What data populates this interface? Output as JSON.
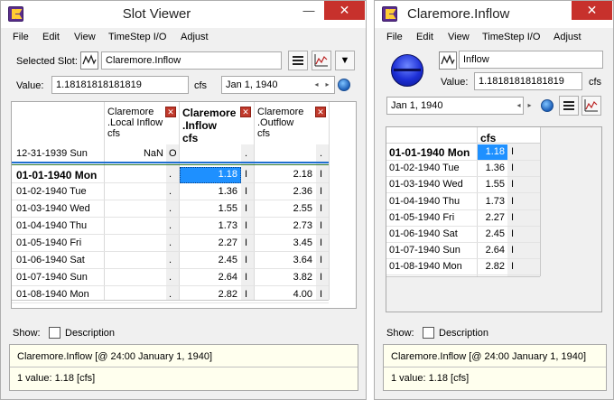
{
  "left_window": {
    "title": "Slot Viewer",
    "menu": [
      "File",
      "Edit",
      "View",
      "TimeStep I/O",
      "Adjust"
    ],
    "selected_slot_label": "Selected Slot:",
    "selected_slot_value": "Claremore.Inflow",
    "value_label": "Value:",
    "value": "1.18181818181819",
    "units": "cfs",
    "date": "Jan 1, 1940",
    "columns": [
      {
        "line1": "Claremore",
        "line2": ".Local Inflow",
        "line3": "cfs"
      },
      {
        "line1": "Claremore",
        "line2": ".Inflow",
        "line3": "cfs"
      },
      {
        "line1": "Claremore",
        "line2": ".Outflow",
        "line3": "cfs"
      }
    ],
    "pre_row": {
      "date": "12-31-1939 Sun",
      "c1": "NaN",
      "f1": "O",
      "f2": ".",
      "f3": "."
    },
    "rows": [
      {
        "date": "01-01-1940 Mon",
        "f1": ".",
        "v2": "1.18",
        "f2": "I",
        "v3": "2.18",
        "f3": "I"
      },
      {
        "date": "01-02-1940 Tue",
        "f1": ".",
        "v2": "1.36",
        "f2": "I",
        "v3": "2.36",
        "f3": "I"
      },
      {
        "date": "01-03-1940 Wed",
        "f1": ".",
        "v2": "1.55",
        "f2": "I",
        "v3": "2.55",
        "f3": "I"
      },
      {
        "date": "01-04-1940 Thu",
        "f1": ".",
        "v2": "1.73",
        "f2": "I",
        "v3": "2.73",
        "f3": "I"
      },
      {
        "date": "01-05-1940 Fri",
        "f1": ".",
        "v2": "2.27",
        "f2": "I",
        "v3": "3.45",
        "f3": "I"
      },
      {
        "date": "01-06-1940 Sat",
        "f1": ".",
        "v2": "2.45",
        "f2": "I",
        "v3": "3.64",
        "f3": "I"
      },
      {
        "date": "01-07-1940 Sun",
        "f1": ".",
        "v2": "2.64",
        "f2": "I",
        "v3": "3.82",
        "f3": "I"
      },
      {
        "date": "01-08-1940 Mon",
        "f1": ".",
        "v2": "2.82",
        "f2": "I",
        "v3": "4.00",
        "f3": "I"
      }
    ],
    "show_label": "Show:",
    "description_label": "Description",
    "info_line1": "Claremore.Inflow [@ 24:00 January 1, 1940]",
    "info_line2": "1 value:  1.18 [cfs]"
  },
  "right_window": {
    "title": "Claremore.Inflow",
    "menu": [
      "File",
      "Edit",
      "View",
      "TimeStep I/O",
      "Adjust"
    ],
    "slot_name": "Inflow",
    "value_label": "Value:",
    "value": "1.18181818181819",
    "units": "cfs",
    "date": "Jan 1, 1940",
    "column_header": "cfs",
    "rows": [
      {
        "date": "01-01-1940 Mon",
        "v": "1.18",
        "f": "I"
      },
      {
        "date": "01-02-1940 Tue",
        "v": "1.36",
        "f": "I"
      },
      {
        "date": "01-03-1940 Wed",
        "v": "1.55",
        "f": "I"
      },
      {
        "date": "01-04-1940 Thu",
        "v": "1.73",
        "f": "I"
      },
      {
        "date": "01-05-1940 Fri",
        "v": "2.27",
        "f": "I"
      },
      {
        "date": "01-06-1940 Sat",
        "v": "2.45",
        "f": "I"
      },
      {
        "date": "01-07-1940 Sun",
        "v": "2.64",
        "f": "I"
      },
      {
        "date": "01-08-1940 Mon",
        "v": "2.82",
        "f": "I"
      }
    ],
    "show_label": "Show:",
    "description_label": "Description",
    "info_line1": "Claremore.Inflow [@ 24:00 January 1, 1940]",
    "info_line2": "1 value:  1.18 [cfs]"
  },
  "window_controls": {
    "minimize": "—",
    "maximize": "□",
    "close": "✕"
  },
  "spin_glyphs": {
    "left": "◂",
    "right": "▸"
  },
  "dropdown_glyph": "▼",
  "remove_column_glyph": "✕",
  "colors": {
    "close": "#c7312c",
    "selection": "#1e90ff",
    "accent_line": "#1f6fd1",
    "separator": "#2f7a2f"
  }
}
